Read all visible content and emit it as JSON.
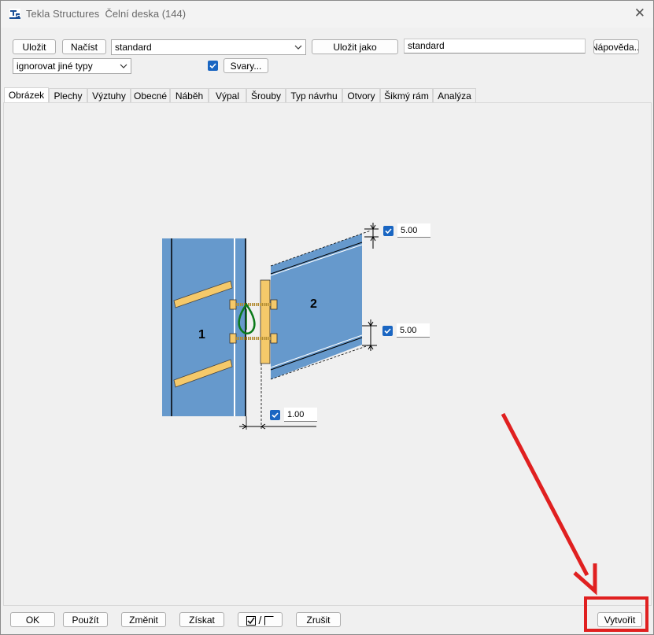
{
  "window": {
    "app_name": "Tekla Structures",
    "title": "Čelní deska (144)"
  },
  "toolbar": {
    "save_label": "Uložit",
    "load_label": "Načíst",
    "preset_value": "standard",
    "save_as_label": "Uložit jako",
    "save_as_value": "standard",
    "help_label": "Nápověda...",
    "type_filter_value": "ignorovat jiné typy",
    "welds_checked": true,
    "welds_label": "Svary..."
  },
  "tabs": [
    {
      "label": "Obrázek",
      "active": true
    },
    {
      "label": "Plechy"
    },
    {
      "label": "Výztuhy"
    },
    {
      "label": "Obecné"
    },
    {
      "label": "Náběh"
    },
    {
      "label": "Výpal"
    },
    {
      "label": "Šrouby"
    },
    {
      "label": "Typ návrhu"
    },
    {
      "label": "Otvory"
    },
    {
      "label": "Šikmý rám"
    },
    {
      "label": "Analýza"
    }
  ],
  "picture": {
    "part1_label": "1",
    "part2_label": "2",
    "dim_top": {
      "checked": true,
      "value": "5.00"
    },
    "dim_bottom": {
      "checked": true,
      "value": "5.00"
    },
    "dim_gap": {
      "checked": true,
      "value": "1.00"
    }
  },
  "footer": {
    "ok_label": "OK",
    "apply_label": "Použít",
    "modify_label": "Změnit",
    "get_label": "Získat",
    "toggle_label": "/",
    "cancel_label": "Zrušit",
    "create_label": "Vytvořit"
  },
  "colors": {
    "steel_blue": "#6699cc",
    "plate_yellow": "#f5c96a",
    "accent_check": "#1a66c2",
    "annotation_red": "#e02020"
  }
}
